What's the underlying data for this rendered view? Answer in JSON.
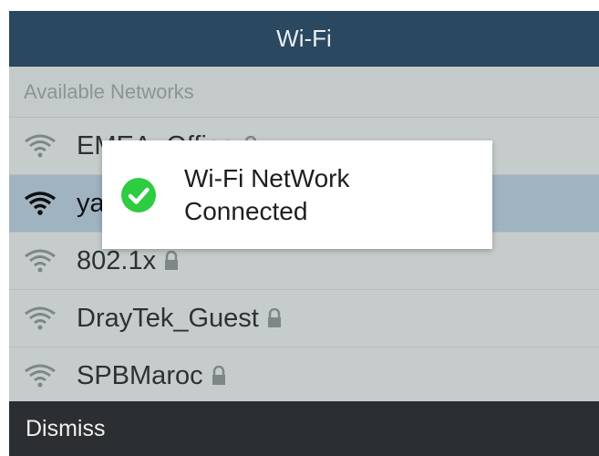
{
  "window": {
    "title": "Wi-Fi"
  },
  "section_header": "Available Networks",
  "networks": [
    {
      "name": "EMEA_Office",
      "secured": true,
      "icon": "wifi-icon",
      "selected": false
    },
    {
      "name": "yal",
      "secured": false,
      "icon": "wifi-icon",
      "selected": true
    },
    {
      "name": "802.1x",
      "secured": true,
      "icon": "wifi-icon",
      "selected": false
    },
    {
      "name": "DrayTek_Guest",
      "secured": true,
      "icon": "wifi-icon",
      "selected": false
    },
    {
      "name": "SPBMaroc",
      "secured": true,
      "icon": "wifi-icon",
      "selected": false
    }
  ],
  "toast": {
    "line1": "Wi-Fi NetWork",
    "line2": "Connected",
    "icon": "check-circle-icon",
    "icon_color": "#2ecc40"
  },
  "softkeys": {
    "dismiss": "Dismiss"
  },
  "colors": {
    "titlebar": "#2a4960",
    "list_bg": "#c6cccb",
    "selected_row": "#9fb3c0",
    "softkey_bar": "#2b2f31"
  }
}
